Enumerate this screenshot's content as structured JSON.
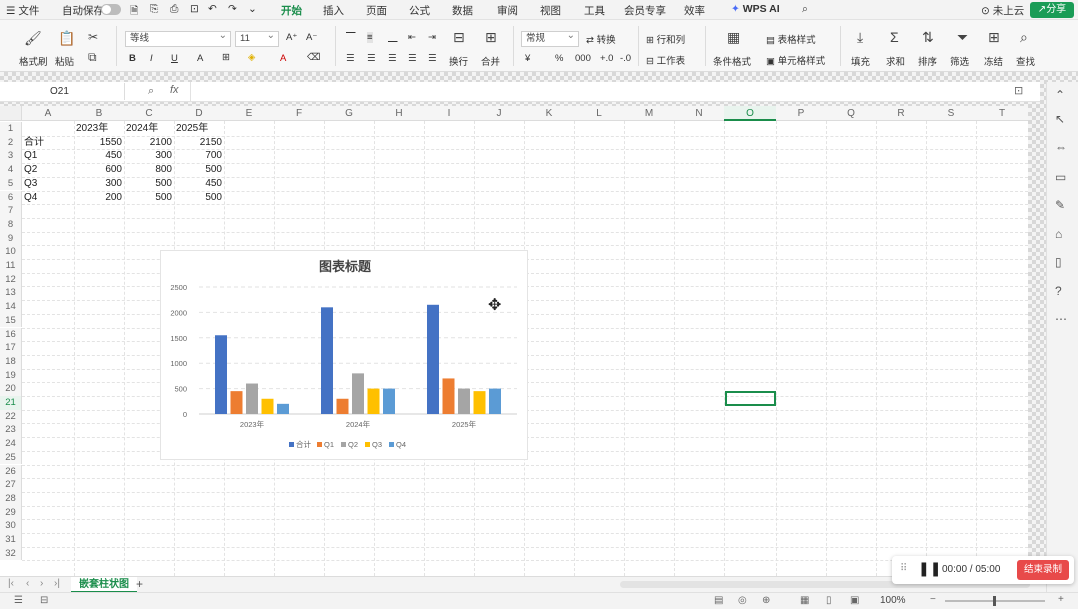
{
  "menubar": {
    "items": [
      "文件",
      "自动保存",
      "开始",
      "插入",
      "页面",
      "公式",
      "数据",
      "审阅",
      "视图",
      "工具",
      "会员专享",
      "效率",
      "WPS AI"
    ],
    "cloud": "未上云",
    "share": "分享"
  },
  "ribbon": {
    "format_painter": "格式刷",
    "paste": "粘贴",
    "font_name": "等线",
    "font_size": "11",
    "wrap": "换行",
    "merge": "合并",
    "number_format": "常规",
    "convert": "转换",
    "row_col": "行和列",
    "worksheet": "工作表",
    "cond_format": "条件格式",
    "table_style": "表格样式",
    "cell_style": "单元格样式",
    "fill": "填充",
    "sum": "求和",
    "sort": "排序",
    "filter": "筛选",
    "freeze": "冻结",
    "find": "查找"
  },
  "formula_bar": {
    "name_box": "O21",
    "fx": "fx",
    "formula": ""
  },
  "columns": [
    "A",
    "B",
    "C",
    "D",
    "E",
    "F",
    "G",
    "H",
    "I",
    "J",
    "K",
    "L",
    "M",
    "N",
    "O",
    "P",
    "Q",
    "R",
    "S",
    "T"
  ],
  "selected_column": "O",
  "selected_row": 21,
  "rows": [
    1,
    2,
    3,
    4,
    5,
    6,
    7,
    8,
    9,
    10,
    11,
    12,
    13,
    14,
    15,
    16,
    17,
    18,
    19,
    20,
    21,
    22,
    23,
    24,
    25,
    26,
    27,
    28,
    29,
    30,
    31,
    32
  ],
  "cells": {
    "B1": "2023年",
    "C1": "2024年",
    "D1": "2025年",
    "A2": "合计",
    "B2": "1550",
    "C2": "2100",
    "D2": "2150",
    "A3": "Q1",
    "B3": "450",
    "C3": "300",
    "D3": "700",
    "A4": "Q2",
    "B4": "600",
    "C4": "800",
    "D4": "500",
    "A5": "Q3",
    "B5": "300",
    "C5": "500",
    "D5": "450",
    "A6": "Q4",
    "B6": "200",
    "C6": "500",
    "D6": "500"
  },
  "chart_data": {
    "type": "bar",
    "title": "图表标题",
    "categories": [
      "2023年",
      "2024年",
      "2025年"
    ],
    "series": [
      {
        "name": "合计",
        "values": [
          1550,
          2100,
          2150
        ],
        "color": "#4472c4"
      },
      {
        "name": "Q1",
        "values": [
          450,
          300,
          700
        ],
        "color": "#ed7d31"
      },
      {
        "name": "Q2",
        "values": [
          600,
          800,
          500
        ],
        "color": "#a5a5a5"
      },
      {
        "name": "Q3",
        "values": [
          300,
          500,
          450
        ],
        "color": "#ffc000"
      },
      {
        "name": "Q4",
        "values": [
          200,
          500,
          500
        ],
        "color": "#5b9bd5"
      }
    ],
    "yticks": [
      "0",
      "500",
      "1000",
      "1500",
      "2000",
      "2500"
    ],
    "ylim": [
      0,
      2500
    ],
    "grid": true,
    "legend": "bottom"
  },
  "sheet_tabs": {
    "active": "嵌套柱状图",
    "add": "+"
  },
  "recorder": {
    "time": "00:00 / 05:00",
    "stop": "结束录制"
  },
  "status": {
    "zoom": "100%"
  },
  "colors": {
    "accent": "#1a8d4b",
    "share": "#1a9c56",
    "record": "#e84a4a"
  }
}
